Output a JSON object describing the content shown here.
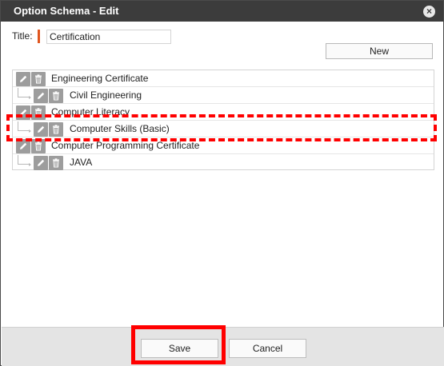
{
  "window": {
    "title": "Option Schema - Edit",
    "close_glyph": "×"
  },
  "form": {
    "title_label": "Title:",
    "title_value": "Certification"
  },
  "toolbar": {
    "new_label": "New"
  },
  "tree": {
    "items": [
      {
        "label": "Engineering Certificate",
        "level": 0
      },
      {
        "label": "Civil Engineering",
        "level": 1
      },
      {
        "label": "Computer Literacy",
        "level": 0
      },
      {
        "label": "Computer Skills (Basic)",
        "level": 1
      },
      {
        "label": "Computer Programming Certificate",
        "level": 0
      },
      {
        "label": "JAVA",
        "level": 1
      }
    ]
  },
  "icons": {
    "edit": "pencil-icon",
    "delete": "trash-icon"
  },
  "footer": {
    "save_label": "Save",
    "cancel_label": "Cancel"
  },
  "colors": {
    "titlebar": "#3c3c3c",
    "required_marker": "#e0561f",
    "icon_button": "#9d9d9d",
    "footer_bg": "#e4e4e4",
    "highlight": "#ff0000"
  }
}
